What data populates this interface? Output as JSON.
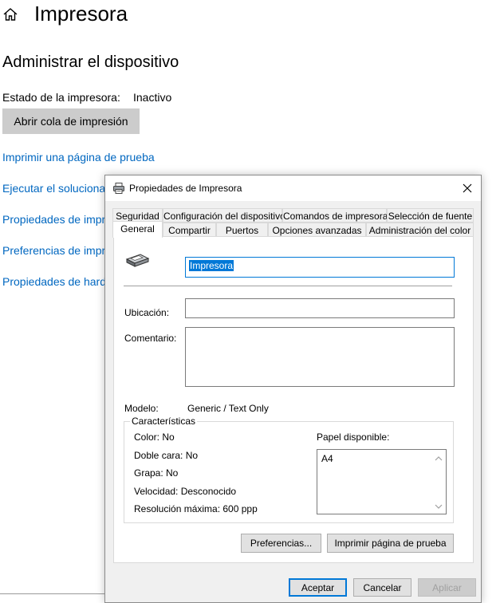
{
  "settings_page": {
    "title": "Impresora",
    "section_title": "Administrar el dispositivo",
    "status_label": "Estado de la impresora:",
    "status_value": "Inactivo",
    "open_queue_button": "Abrir cola de impresión",
    "links": [
      "Imprimir una página de prueba",
      "Ejecutar el solucionador de problemas",
      "Propiedades de impresora",
      "Preferencias de impresión",
      "Propiedades de hardware"
    ]
  },
  "dialog": {
    "title": "Propiedades de Impresora",
    "tabs_row1": [
      "Seguridad",
      "Configuración del dispositivo",
      "Comandos de impresora",
      "Selección de fuente"
    ],
    "tabs_row2": [
      "General",
      "Compartir",
      "Puertos",
      "Opciones avanzadas",
      "Administración del color"
    ],
    "active_tab": "General",
    "printer_name": "Impresora",
    "location_label": "Ubicación:",
    "location_value": "",
    "comment_label": "Comentario:",
    "comment_value": "",
    "model_label": "Modelo:",
    "model_value": "Generic / Text Only",
    "features": {
      "title": "Características",
      "color": "Color: No",
      "duplex": "Doble cara: No",
      "staple": "Grapa: No",
      "speed": "Velocidad: Desconocido",
      "max_resolution": "Resolución máxima: 600 ppp",
      "paper_label": "Papel disponible:",
      "paper_items": [
        "A4"
      ]
    },
    "preferences_button": "Preferencias...",
    "test_page_button": "Imprimir página de prueba",
    "ok_button": "Aceptar",
    "cancel_button": "Cancelar",
    "apply_button": "Aplicar"
  },
  "colors": {
    "link": "#0067c0",
    "accent": "#0078d7"
  }
}
